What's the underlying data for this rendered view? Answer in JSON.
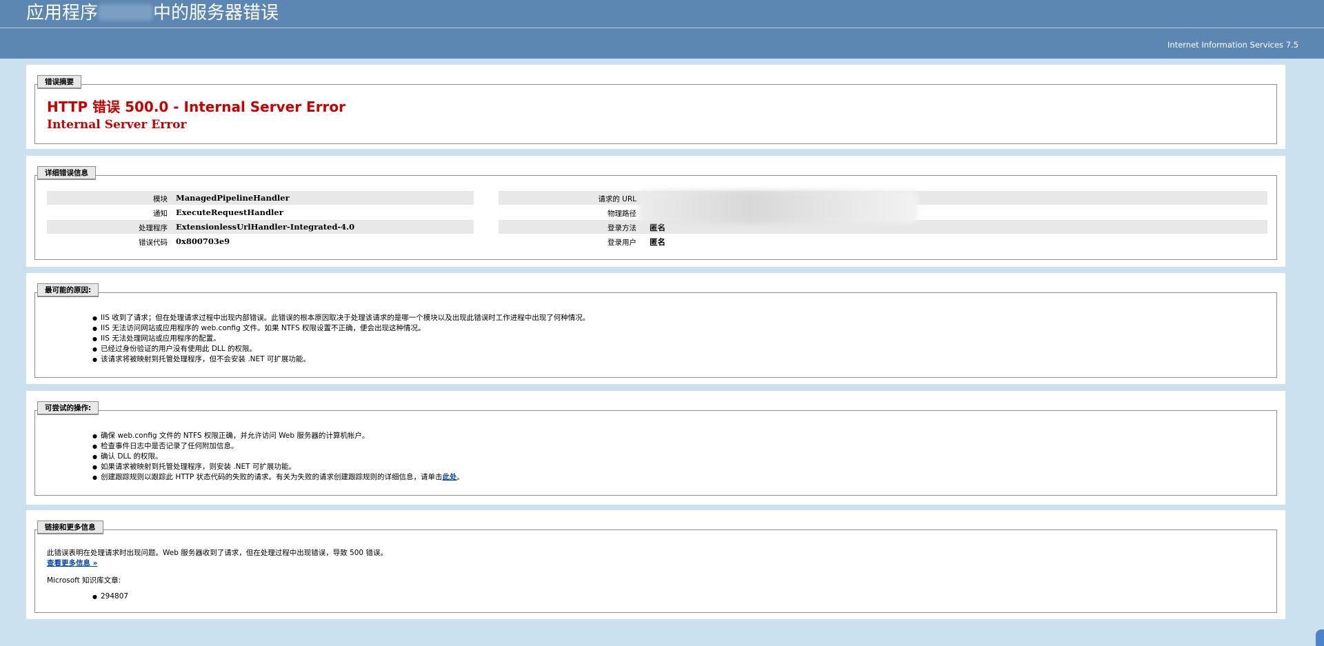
{
  "header": {
    "title_prefix": "应用程序",
    "title_suffix": "中的服务器错误",
    "server": "Internet Information Services 7.5"
  },
  "summary": {
    "legend": "错误摘要",
    "title": "HTTP 错误 500.0 - Internal Server Error",
    "subtitle": "Internal Server Error"
  },
  "details": {
    "legend": "详细错误信息",
    "left": [
      {
        "label": "模块",
        "value": "ManagedPipelineHandler"
      },
      {
        "label": "通知",
        "value": "ExecuteRequestHandler"
      },
      {
        "label": "处理程序",
        "value": "ExtensionlessUrlHandler-Integrated-4.0"
      },
      {
        "label": "错误代码",
        "value": "0x800703e9"
      }
    ],
    "right": [
      {
        "label": "请求的 URL",
        "value": ""
      },
      {
        "label": "物理路径",
        "value": ""
      },
      {
        "label": "登录方法",
        "value": "匿名"
      },
      {
        "label": "登录用户",
        "value": "匿名"
      }
    ]
  },
  "causes": {
    "legend": "最可能的原因:",
    "items": [
      "IIS 收到了请求；但在处理请求过程中出现内部错误。此错误的根本原因取决于处理该请求的是哪一个模块以及出现此错误时工作进程中出现了何种情况。",
      "IIS 无法访问网站或应用程序的 web.config 文件。如果 NTFS 权限设置不正确，便会出现这种情况。",
      "IIS 无法处理网站或应用程序的配置。",
      "已经过身份验证的用户没有使用此 DLL 的权限。",
      "该请求将被映射到托管处理程序，但不会安装 .NET 可扩展功能。"
    ]
  },
  "actions": {
    "legend": "可尝试的操作:",
    "items": [
      "确保 web.config 文件的 NTFS 权限正确，并允许访问 Web 服务器的计算机帐户。",
      "检查事件日志中是否记录了任何附加信息。",
      "确认 DLL 的权限。",
      "如果请求被映射到托管处理程序，则安装 .NET 可扩展功能。"
    ],
    "last_item": "创建跟踪规则以跟踪此 HTTP 状态代码的失败的请求。有关为失败的请求创建跟踪规则的详细信息，请单击",
    "last_link": "此处",
    "last_end": "。"
  },
  "links": {
    "legend": "链接和更多信息",
    "description": "此错误表明在处理请求时出现问题。Web 服务器收到了请求，但在处理过程中出现错误，导致 500 错误。",
    "more_link": "查看更多信息 »",
    "kb_label": "Microsoft 知识库文章:",
    "kb_items": [
      "294807"
    ]
  }
}
